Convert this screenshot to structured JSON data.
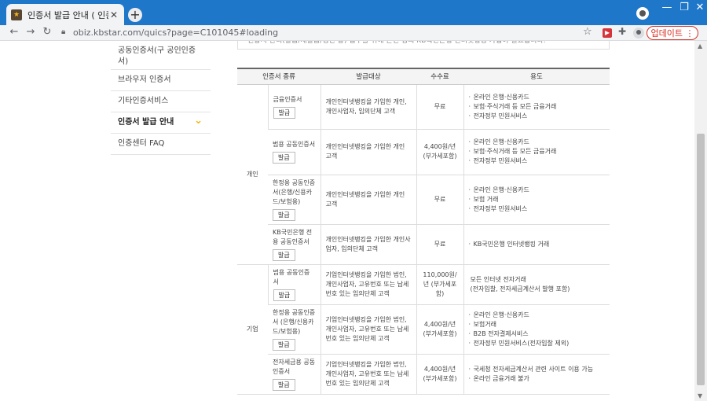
{
  "browser": {
    "tab_title": "인증서 발급 안내 ( 인증센터(개인",
    "favicon_text": "★",
    "url": "obiz.kbstar.com/quics?page=C101045#loading",
    "update_label": "업데이트",
    "accent_color": "#1f77c9"
  },
  "sidebar": {
    "items": [
      {
        "label": "공동인증서(구 공인인증서)"
      },
      {
        "label": "브라우저 인증서"
      },
      {
        "label": "기타인증서비스"
      },
      {
        "label": "인증서 발급 안내",
        "active": true
      },
      {
        "label": "인증센터 FAQ"
      }
    ]
  },
  "notice_text": "인증서 관리(발급/재발급/갱신 등) 업무를 위해 본인 명의 KB국민은행 인터넷뱅킹 가입이 필요합니다.",
  "table": {
    "headers": [
      "인증서 종류",
      "발급대상",
      "수수료",
      "용도"
    ],
    "issue_label": "발급",
    "groups": [
      {
        "group": "개인",
        "rows": [
          {
            "type": "금융인증서",
            "target": "개인인터넷뱅킹을 가입한 개인, 개인사업자, 임의단체 고객",
            "fee": "무료",
            "usage": [
              "온라인 은행·신용카드",
              "보험·주식거래 등 모든 금융거래",
              "전자정부 민원서비스"
            ]
          },
          {
            "type": "범용 공동인증서",
            "target": "개인인터넷뱅킹을 가입한 개인 고객",
            "fee": "4,400원/년 (부가세포함)",
            "usage": [
              "온라인 은행·신용카드",
              "보험·주식거래 등 모든 금융거래",
              "전자정부 민원서비스"
            ]
          },
          {
            "type": "한정용 공동인증서(은행/신용카드/보험용)",
            "target": "개인인터넷뱅킹을 가입한 개인 고객",
            "fee": "무료",
            "usage": [
              "온라인 은행·신용카드",
              "보험 거래",
              "전자정부 민원서비스"
            ]
          },
          {
            "type": "KB국민은행 전용 공동인증서",
            "target": "개인인터넷뱅킹을 가입한 개인사업자, 임의단체 고객",
            "fee": "무료",
            "usage": [
              "KB국민은행 인터넷뱅킹 거래"
            ]
          }
        ]
      },
      {
        "group": "기업",
        "rows": [
          {
            "type": "범용 공동인증서",
            "target": "기업인터넷뱅킹을 가입한 법인, 개인사업자, 고유번호 또는 납세번호 있는 임의단체 고객",
            "fee": "110,000원/년 (부가세포함)",
            "usage_plain": [
              "모든 인터넷 전자거래",
              "(전자입찰, 전자세금계산서 발행 포함)"
            ]
          },
          {
            "type": "한정용 공동인증서 (은행/신용카드/보험용)",
            "target": "기업인터넷뱅킹을 가입한 법인, 개인사업자, 고유번호 또는 납세번호 있는 임의단체 고객",
            "fee": "4,400원/년 (부가세포함)",
            "usage": [
              "온라인 은행·신용카드",
              "보험거래",
              "B2B 전자결제서비스",
              "전자정부 민원서비스(전자입찰 제외)"
            ]
          },
          {
            "type": "전자세금용 공동인증서",
            "target": "기업인터넷뱅킹을 가입한 법인, 개인사업자, 고유번호 또는 납세번호 있는 임의단체 고객",
            "fee": "4,400원/년 (부가세포함)",
            "usage": [
              "국세청 전자세금계산서 관련 사이트 이용 가능",
              "온라인 금융거래 불가"
            ]
          }
        ]
      }
    ]
  }
}
